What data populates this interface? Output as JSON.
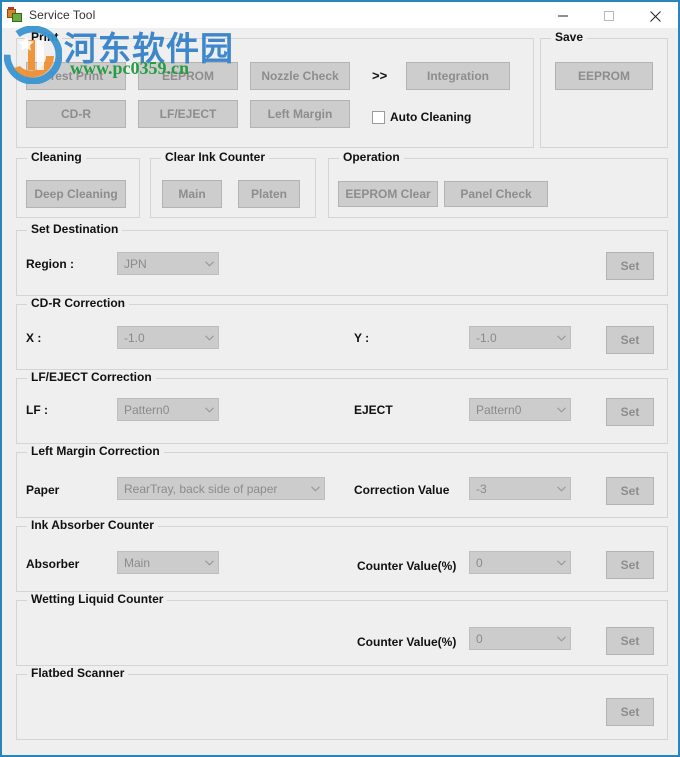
{
  "window": {
    "title": "Service Tool",
    "icon": "app-icon",
    "controls": {
      "minimize": "minimize-icon",
      "maximize": "maximize-icon",
      "close": "close-icon"
    },
    "border_color": "#2a84bd"
  },
  "watermark": {
    "chinese": "河东软件园",
    "url": "www.pc0359.cn",
    "chinese_color": "#2f7fc8",
    "url_color": "#1f9a3c"
  },
  "print_group": {
    "label": "Print",
    "buttons": {
      "test_print": "Test Print",
      "eeprom": "EEPROM",
      "nozzle_check": "Nozzle Check",
      "integration": "Integration",
      "cdr": "CD-R",
      "lf_eject": "LF/EJECT",
      "left_margin": "Left Margin"
    },
    "separator": ">>",
    "auto_cleaning": {
      "label": "Auto Cleaning",
      "checked": false
    }
  },
  "save_group": {
    "label": "Save",
    "eeprom_button": "EEPROM"
  },
  "cleaning_group": {
    "label": "Cleaning",
    "deep_cleaning": "Deep Cleaning"
  },
  "clear_ink_counter_group": {
    "label": "Clear Ink Counter",
    "main": "Main",
    "platen": "Platen"
  },
  "operation_group": {
    "label": "Operation",
    "eeprom_clear": "EEPROM Clear",
    "panel_check": "Panel Check"
  },
  "set_destination": {
    "label": "Set Destination",
    "region_label": "Region :",
    "region_value": "JPN",
    "set_button": "Set"
  },
  "cdr_correction": {
    "label": "CD-R Correction",
    "x_label": "X :",
    "x_value": "-1.0",
    "y_label": "Y :",
    "y_value": "-1.0",
    "set_button": "Set"
  },
  "lf_eject_correction": {
    "label": "LF/EJECT Correction",
    "lf_label": "LF :",
    "lf_value": "Pattern0",
    "eject_label": "EJECT",
    "eject_value": "Pattern0",
    "set_button": "Set"
  },
  "left_margin_correction": {
    "label": "Left Margin Correction",
    "paper_label": "Paper",
    "paper_value": "RearTray, back side of paper",
    "correction_label": "Correction Value",
    "correction_value": "-3",
    "set_button": "Set"
  },
  "ink_absorber_counter": {
    "label": "Ink Absorber Counter",
    "absorber_label": "Absorber",
    "absorber_value": "Main",
    "counter_label": "Counter Value(%)",
    "counter_value": "0",
    "set_button": "Set"
  },
  "wetting_liquid_counter": {
    "label": "Wetting Liquid Counter",
    "counter_label": "Counter Value(%)",
    "counter_value": "0",
    "set_button": "Set"
  },
  "flatbed_scanner": {
    "label": "Flatbed Scanner",
    "set_button": "Set"
  }
}
